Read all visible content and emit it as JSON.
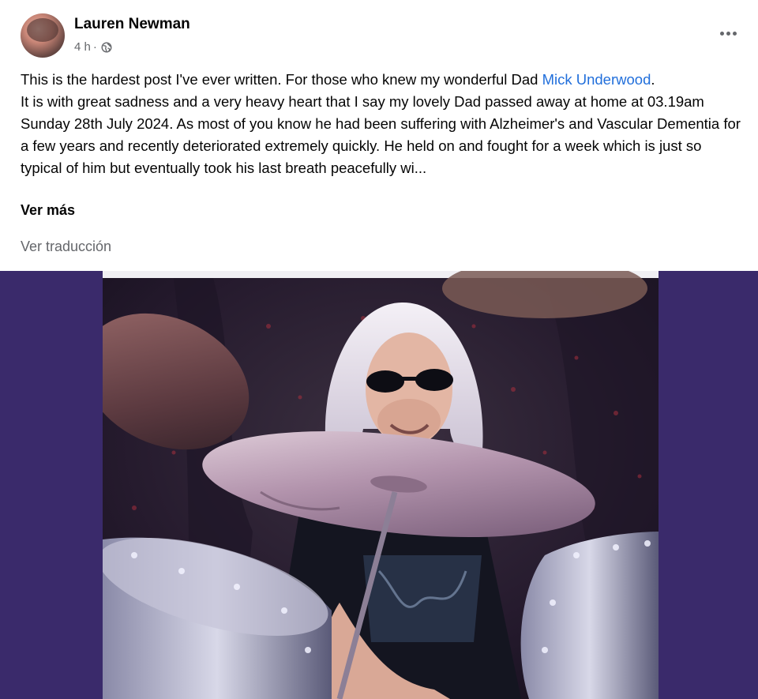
{
  "post": {
    "author": "Lauren Newman",
    "time": "4 h",
    "separator": "·",
    "body_intro": "This is the hardest post I've ever written. For those who knew my wonderful Dad ",
    "mention": "Mick Underwood",
    "body_intro_end": ".",
    "body_main": "It is with great sadness and a very heavy heart that I say my lovely Dad passed away at home at 03.19am Sunday 28th July 2024. As most of you know he had been suffering with Alzheimer's and Vascular Dementia for a few years and recently deteriorated extremely quickly. He held on and fought for a week which is just so typical of him but eventually took his last breath peacefully wi...",
    "see_more": "Ver más",
    "translate": "Ver traducción"
  },
  "icons": {
    "audience": "globe-icon",
    "menu": "more-horizontal-icon"
  },
  "colors": {
    "link": "#216fdb",
    "secondary_text": "#65676b",
    "media_background": "#3a2a6b"
  }
}
